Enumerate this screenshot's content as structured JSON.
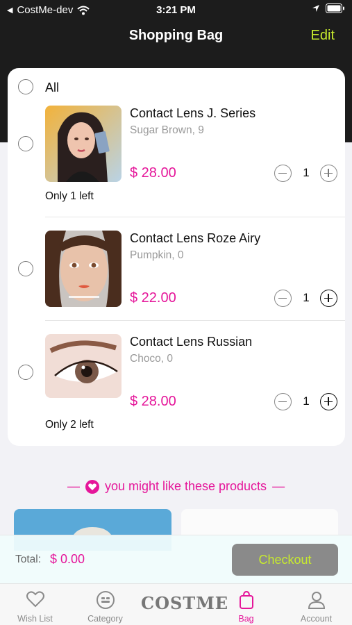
{
  "status_bar": {
    "carrier": "CostMe-dev",
    "time": "3:21 PM"
  },
  "nav": {
    "title": "Shopping Bag",
    "edit_label": "Edit"
  },
  "select_all_label": "All",
  "items": [
    {
      "name": "Contact Lens J. Series",
      "variant": "Sugar Brown, 9",
      "price": "$ 28.00",
      "quantity": "1",
      "stock_note": "Only 1 left"
    },
    {
      "name": "Contact Lens Roze Airy",
      "variant": "Pumpkin, 0",
      "price": "$ 22.00",
      "quantity": "1",
      "stock_note": ""
    },
    {
      "name": "Contact Lens Russian",
      "variant": "Choco, 0",
      "price": "$ 28.00",
      "quantity": "1",
      "stock_note": "Only 2 left"
    }
  ],
  "suggestions": {
    "heading": "you might like these products",
    "dash": "—"
  },
  "total": {
    "label": "Total:",
    "value": "$ 0.00"
  },
  "checkout_label": "Checkout",
  "tabs": [
    {
      "label": "Wish List",
      "icon": "heart-icon"
    },
    {
      "label": "Category",
      "icon": "category-icon"
    },
    {
      "label": "COSTME",
      "icon": "costme-logo"
    },
    {
      "label": "Bag",
      "icon": "bag-icon"
    },
    {
      "label": "Account",
      "icon": "account-icon"
    }
  ],
  "colors": {
    "accent": "#e5169a",
    "highlight": "#c7ea2e",
    "header_bg": "#1c1c1c"
  }
}
